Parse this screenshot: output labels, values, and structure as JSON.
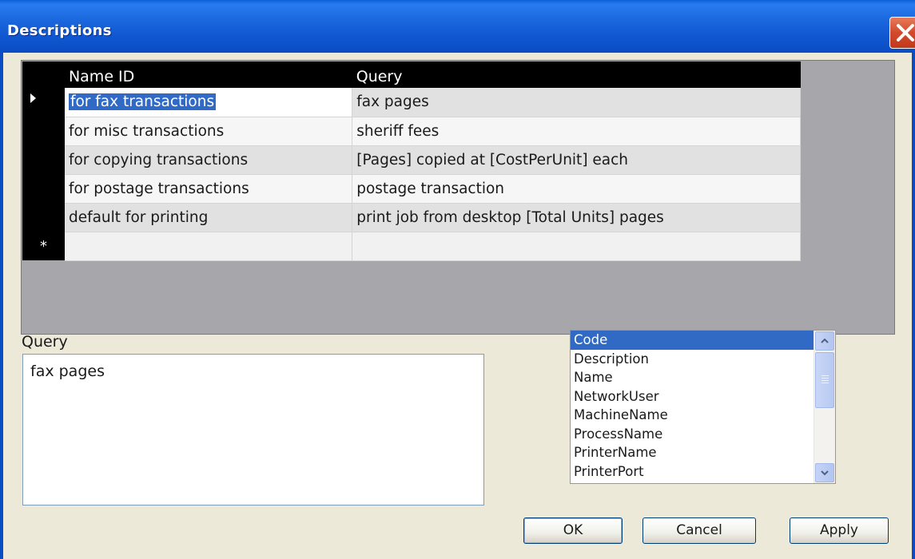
{
  "window": {
    "title": "Descriptions"
  },
  "grid": {
    "columns": [
      "Name ID",
      "Query"
    ],
    "rows": [
      {
        "name_id": "for fax transactions",
        "query": "fax pages"
      },
      {
        "name_id": "for misc transactions",
        "query": "sheriff fees"
      },
      {
        "name_id": "for copying transactions",
        "query": "[Pages] copied at [CostPerUnit] each"
      },
      {
        "name_id": "for postage transactions",
        "query": "postage transaction"
      },
      {
        "name_id": "default for printing",
        "query": "print job from desktop [Total Units] pages"
      }
    ],
    "new_row_marker": "*",
    "current_row_marker": "▸"
  },
  "query_panel": {
    "label": "Query",
    "value": "fax pages"
  },
  "field_list": {
    "items": [
      "Code",
      "Description",
      "Name",
      "NetworkUser",
      "MachineName",
      "ProcessName",
      "PrinterName",
      "PrinterPort"
    ],
    "selected": "Code"
  },
  "buttons": {
    "ok": "OK",
    "cancel": "Cancel",
    "apply": "Apply"
  },
  "colors": {
    "title_bar": "#0f57d0",
    "selection": "#316ac5",
    "grid_header": "#000000",
    "window_bg": "#ece9d8"
  }
}
